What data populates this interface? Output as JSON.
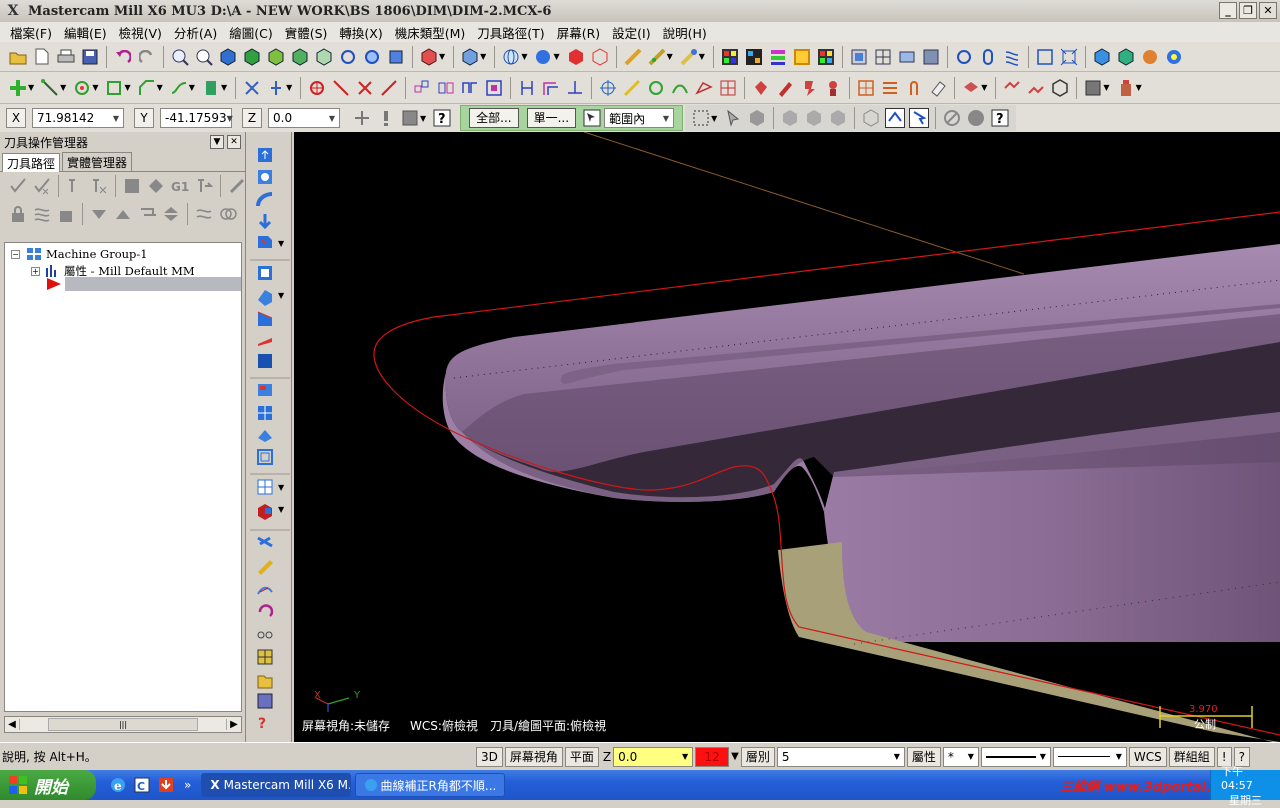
{
  "titlebar": {
    "app_icon": "mastercam-x-icon",
    "title": "Mastercam Mill X6 MU3  D:\\A - NEW WORK\\BS 1806\\DIM\\DIM-2.MCX-6",
    "min": "_",
    "max": "❐",
    "close": "✕"
  },
  "menu": [
    "檔案(F)",
    "編輯(E)",
    "檢視(V)",
    "分析(A)",
    "繪圖(C)",
    "實體(S)",
    "轉換(X)",
    "機床類型(M)",
    "刀具路徑(T)",
    "屏幕(R)",
    "設定(I)",
    "說明(H)"
  ],
  "coords": {
    "x_label": "X",
    "x_value": "71.98142",
    "y_label": "Y",
    "y_value": "-41.17593",
    "z_label": "Z",
    "z_value": "0.0"
  },
  "selection": {
    "all_button": "全部...",
    "single_button": "單一...",
    "mode_value": "範圍內"
  },
  "left_panel": {
    "title": "刀具操作管理器",
    "tab_toolpaths": "刀具路徑",
    "tab_solids": "實體管理器",
    "tree_group": "Machine Group-1",
    "tree_props": "屬性 - Mill Default MM",
    "scroll_mark": "|||"
  },
  "viewport": {
    "gview_status": "屏幕視角:未儲存",
    "wcs_status": "WCS:俯檢視",
    "tplane_status": "刀具/繪圖平面:俯檢視",
    "axis_x": "X",
    "axis_y": "Y",
    "scale_value": "3.970",
    "scale_unit": "公制",
    "watermark": "三維網 www.3dportal.cn",
    "colors": {
      "background": "#000000",
      "part": "#8a6c93",
      "part_light": "#a58aae",
      "stock": "#a8a078",
      "toolpath": "#d01818",
      "guide_line": "#8a5a2a"
    }
  },
  "statusbar": {
    "help": "說明, 按 Alt+H。",
    "mode_3d": "3D",
    "screen_view": "屏幕視角",
    "plane": "平面",
    "z_label": "Z",
    "z_value": "0.0",
    "color_value": "12",
    "level_label": "層別",
    "level_value": "5",
    "attributes": "屬性",
    "point_style": "*",
    "wcs": "WCS",
    "group": "群組組",
    "help_btn": "!",
    "end_btn": "?"
  },
  "taskbar": {
    "start": "開始",
    "chevron": "»",
    "items": [
      "Mastercam Mill X6 M...",
      "曲線補正R角都不順..."
    ],
    "time": "下午 04:57",
    "day": "星期三"
  }
}
